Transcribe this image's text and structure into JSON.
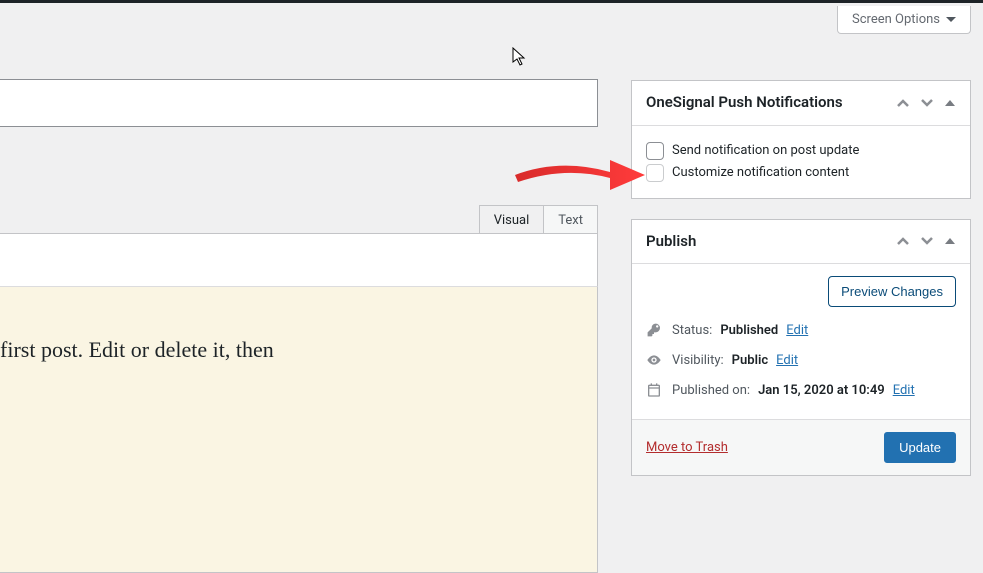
{
  "header": {
    "screen_options": "Screen Options"
  },
  "editor": {
    "tabs": {
      "visual": "Visual",
      "text": "Text"
    },
    "content": "first post. Edit or delete it, then"
  },
  "onesignal_box": {
    "title": "OneSignal Push Notifications",
    "opt_send": "Send notification on post update",
    "opt_customize": "Customize notification content"
  },
  "publish_box": {
    "title": "Publish",
    "preview_label": "Preview Changes",
    "status_label": "Status:",
    "status_value": "Published",
    "visibility_label": "Visibility:",
    "visibility_value": "Public",
    "schedule_label": "Published on:",
    "schedule_value": "Jan 15, 2020 at 10:49",
    "edit_link": "Edit",
    "trash_label": "Move to Trash",
    "update_label": "Update"
  }
}
